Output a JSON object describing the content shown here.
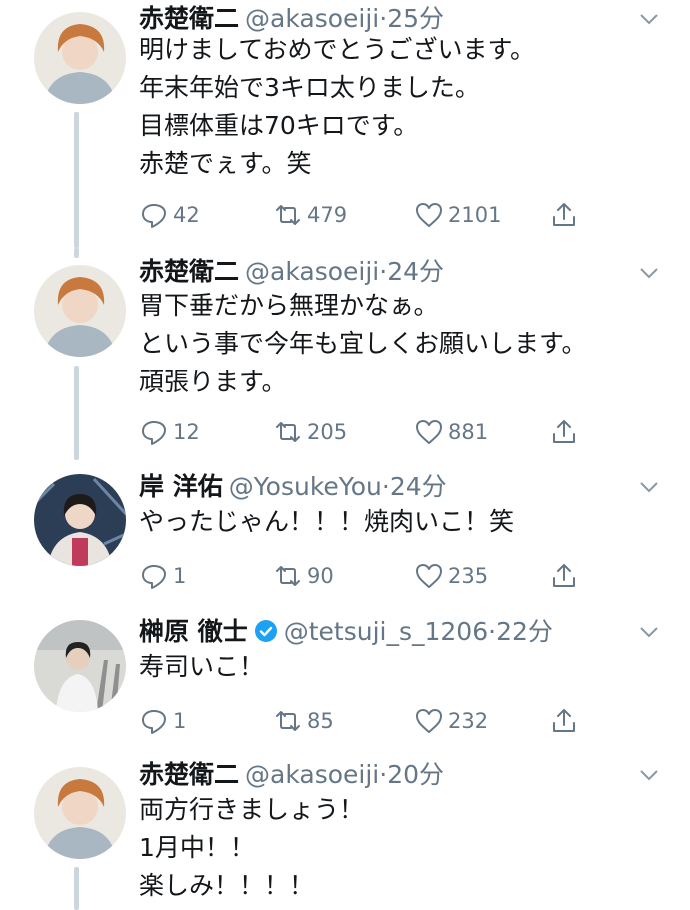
{
  "tweets": [
    {
      "name": "赤楚衛二",
      "handle": "@akasoeiji",
      "time": "25分",
      "verified": false,
      "lines": [
        "明けましておめでとうございます。",
        "年末年始で3キロ太りました。",
        "目標体重は70キロです。",
        "赤楚でぇす。笑"
      ],
      "replies": "42",
      "retweets": "479",
      "likes": "2101"
    },
    {
      "name": "赤楚衛二",
      "handle": "@akasoeiji",
      "time": "24分",
      "verified": false,
      "lines": [
        "胃下垂だから無理かなぁ。",
        "という事で今年も宜しくお願いします。",
        "頑張ります。"
      ],
      "replies": "12",
      "retweets": "205",
      "likes": "881"
    },
    {
      "name": "岸 洋佑",
      "handle": "@YosukeYou",
      "time": "24分",
      "verified": false,
      "lines": [
        "やったじゃん！！！焼肉いこ！笑"
      ],
      "replies": "1",
      "retweets": "90",
      "likes": "235"
    },
    {
      "name": "榊原 徹士",
      "handle": "@tetsuji_s_1206",
      "time": "22分",
      "verified": true,
      "lines": [
        "寿司いこ！"
      ],
      "replies": "1",
      "retweets": "85",
      "likes": "232"
    },
    {
      "name": "赤楚衛二",
      "handle": "@akasoeiji",
      "time": "20分",
      "verified": false,
      "lines": [
        "両方行きましょう！",
        "1月中！！",
        "楽しみ！！！！"
      ]
    }
  ],
  "separator": "·",
  "colors": {
    "text": "#14171a",
    "secondary": "#657786",
    "verified": "#1da1f2",
    "thread": "#ccd6dd"
  },
  "icons": [
    "reply-icon",
    "retweet-icon",
    "like-icon",
    "share-icon",
    "caret-down-icon",
    "verified-badge-icon"
  ]
}
